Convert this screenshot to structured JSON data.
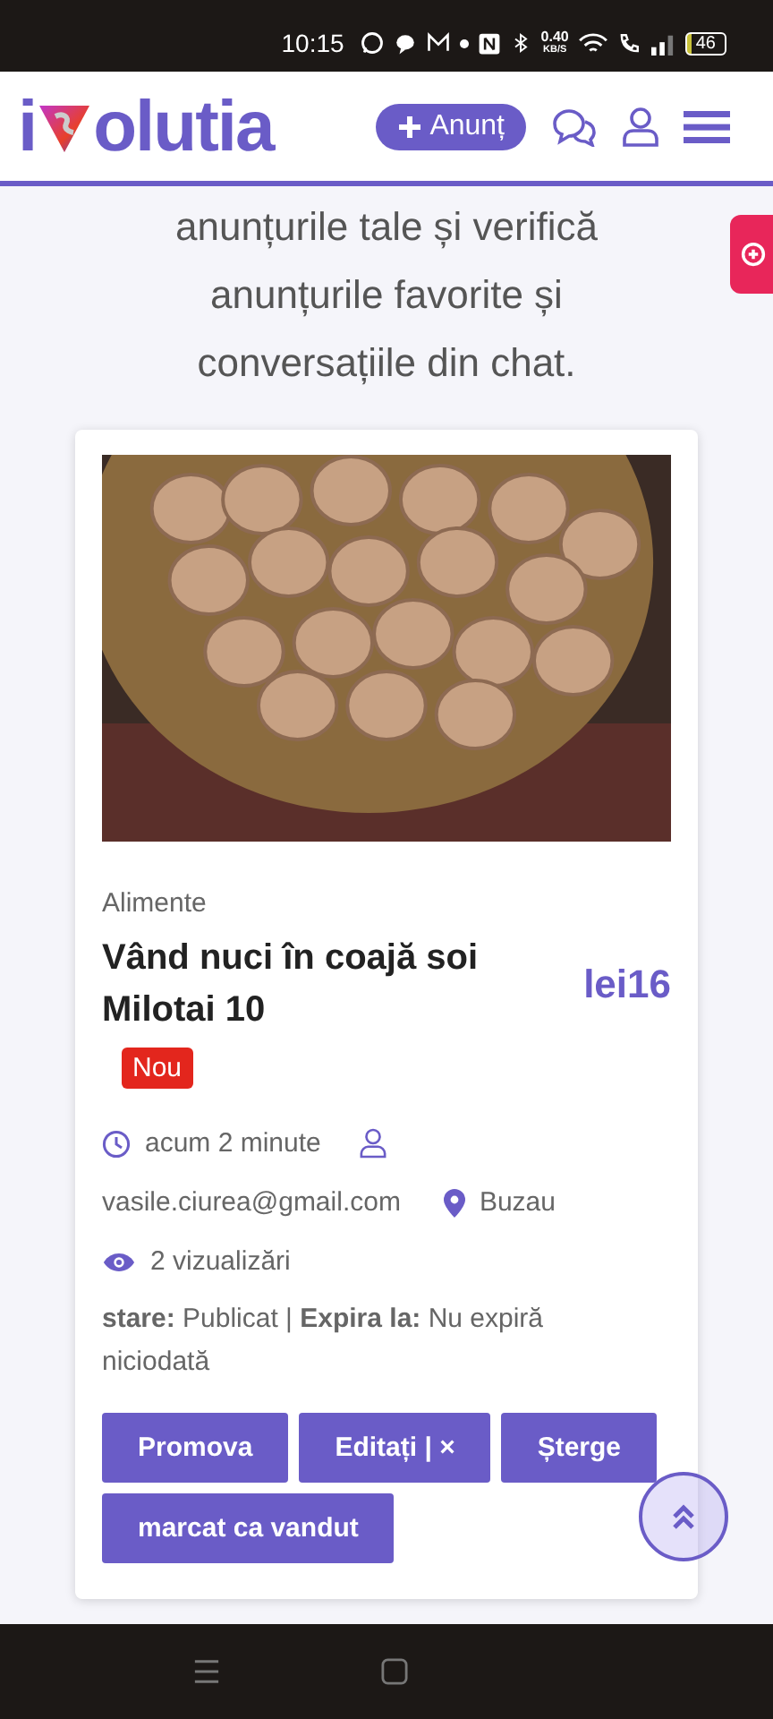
{
  "status_bar": {
    "time": "10:15",
    "speed": "0.40",
    "speed_unit": "KB/S",
    "battery": "46"
  },
  "header": {
    "logo_start": "i",
    "logo_end": "olutia",
    "post_button": "Anunț"
  },
  "intro": "anunțurile tale și verifică anunțurile favorite și conversațiile din chat.",
  "listing": {
    "category": "Alimente",
    "title": "Vând nuci în coajă soi Milotai 10",
    "price": "lei16",
    "badge": "Nou",
    "posted": "acum 2 minute",
    "email": "vasile.ciurea@gmail.com",
    "location": "Buzau",
    "views": "2 vizualizări",
    "status": "**stare:** Publicat |  **Expira la:** Nu expiră niciodată",
    "buttons": [
      "Promova",
      "Editați | ×",
      "Șterge",
      "marcat ca vandut"
    ]
  }
}
